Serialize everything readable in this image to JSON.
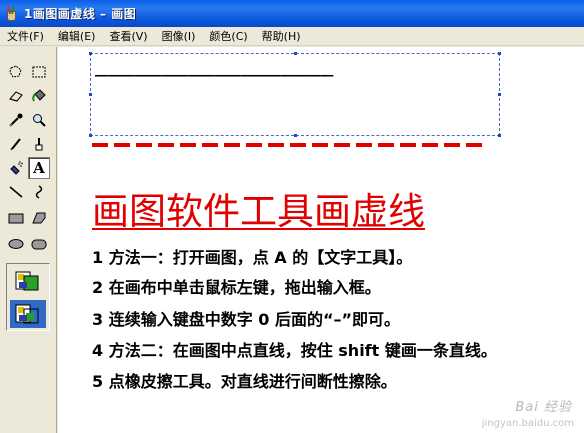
{
  "window": {
    "title": "1画图画虚线 – 画图"
  },
  "menu": [
    {
      "label": "文件(F)",
      "name": "file"
    },
    {
      "label": "编辑(E)",
      "name": "edit"
    },
    {
      "label": "查看(V)",
      "name": "view"
    },
    {
      "label": "图像(I)",
      "name": "image"
    },
    {
      "label": "颜色(C)",
      "name": "colors"
    },
    {
      "label": "帮助(H)",
      "name": "help"
    }
  ],
  "tools": [
    {
      "name": "free-form-select-icon"
    },
    {
      "name": "rect-select-icon"
    },
    {
      "name": "eraser-icon"
    },
    {
      "name": "fill-bucket-icon"
    },
    {
      "name": "color-picker-icon"
    },
    {
      "name": "magnifier-icon"
    },
    {
      "name": "pencil-icon"
    },
    {
      "name": "brush-icon"
    },
    {
      "name": "airbrush-icon"
    },
    {
      "name": "text-tool-icon",
      "label": "A",
      "active": true
    },
    {
      "name": "line-icon"
    },
    {
      "name": "curve-icon"
    },
    {
      "name": "rectangle-icon"
    },
    {
      "name": "polygon-icon"
    },
    {
      "name": "ellipse-icon"
    },
    {
      "name": "rounded-rect-icon"
    }
  ],
  "text_options": [
    {
      "name": "opaque-background-option",
      "selected": false
    },
    {
      "name": "transparent-background-option",
      "selected": true
    }
  ],
  "canvas": {
    "text_box_content": "——————————————————",
    "heading": "画图软件工具画虚线",
    "steps": [
      "1 方法一：打开画图，点 A 的【文字工具】。",
      "2 在画布中单击鼠标左键，拖出输入框。",
      "3 连续输入键盘中数字 0 后面的“–”即可。",
      "4 方法二：在画图中点直线，按住 shift 键画一条直线。",
      "5 点橡皮擦工具。对直线进行间断性擦除。"
    ],
    "watermark": "Bai 经验",
    "watermark_sub": "jingyan.baidu.com"
  },
  "colors": {
    "title_bar": "#0a5fe8",
    "heading": "#e00000",
    "selection_border": "#4a6ebd",
    "selected_option": "#316ac5"
  }
}
